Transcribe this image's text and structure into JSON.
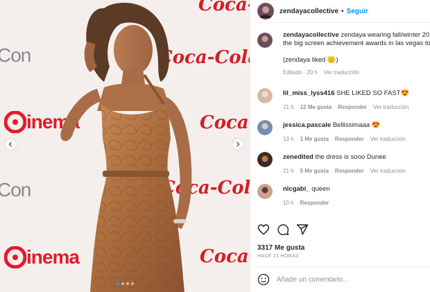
{
  "photo": {
    "wall": {
      "con_1": "Con",
      "cinema_1": "inema",
      "coke_1": "Coca-Cola",
      "con_2": "Con",
      "cinema_2": "inema",
      "coke_2": "Coca-Cola",
      "coke_3": "Coca-Cola",
      "cinema_3": "Cinema"
    },
    "carousel": {
      "count": 4,
      "active": 0
    }
  },
  "header": {
    "username": "zendayacollective",
    "separator": "•",
    "follow_label": "Seguir"
  },
  "caption": {
    "username": "zendayacollective",
    "text": "zendaya wearing fall/winter 20",
    "text_line2": "the big screen achievement awards in las vegas to",
    "liked_note": "(zendaya liked",
    "liked_emoji": "🫡",
    "liked_close": ")",
    "edited": "Editado · 20 h",
    "see_translation": "Ver traducción"
  },
  "comments": [
    {
      "username": "lil_miss_lyss416",
      "text": "SHE LIKED SO FAST",
      "emoji": "😍",
      "time": "21 h",
      "likes": "12 Me gusta",
      "reply": "Responder",
      "translate": "Ver traducción",
      "avatar_color": "#d9b7a8"
    },
    {
      "username": "jessica.pascale",
      "text": "Bellissimaaa",
      "emoji": "😍",
      "time": "13 h",
      "likes": "1 Me gusta",
      "reply": "Responder",
      "translate": "Ver traducción",
      "avatar_color": "#6f8fb5"
    },
    {
      "username": "zenedited",
      "text": "the dress is sooo Dunee",
      "emoji": "",
      "time": "21 h",
      "likes": "5 Me gusta",
      "reply": "Responder",
      "translate": "Ver traducción",
      "avatar_color": "#3b2a22"
    },
    {
      "username": "nicgabi_",
      "text": "queen",
      "emoji": "",
      "time": "10 h",
      "likes": "",
      "reply": "Responder",
      "translate": "",
      "avatar_color": "#c9a48f"
    }
  ],
  "actions": {
    "like_icon": "heart-icon",
    "comment_icon": "comment-icon",
    "share_icon": "send-icon"
  },
  "likes_label": "3317 Me gusta",
  "ago_label": "HACE 21 HORAS",
  "add_comment_placeholder": "Añade un comentario...",
  "colors": {
    "link_blue": "#0095f6",
    "muted": "#8e8e8e",
    "text": "#262626",
    "coke_red": "#d31f26",
    "dress": "#a86a3c"
  }
}
